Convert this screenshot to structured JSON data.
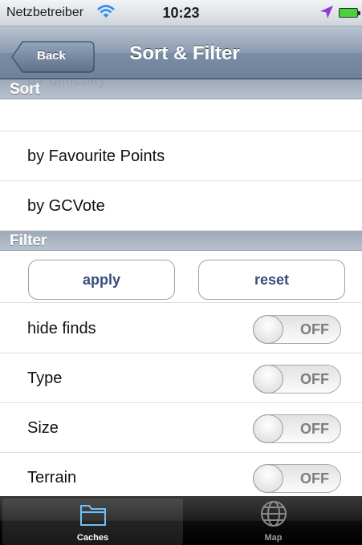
{
  "status_bar": {
    "carrier": "Netzbetreiber",
    "time": "10:23"
  },
  "navbar": {
    "back_label": "Back",
    "title": "Sort & Filter"
  },
  "sort": {
    "header": "Sort",
    "items": [
      "by difficulty",
      "by Favourite Points",
      "by GCVote"
    ]
  },
  "filter": {
    "header": "Filter",
    "apply_label": "apply",
    "reset_label": "reset",
    "toggles": [
      {
        "label": "hide finds",
        "state": "OFF"
      },
      {
        "label": "Type",
        "state": "OFF"
      },
      {
        "label": "Size",
        "state": "OFF"
      },
      {
        "label": "Terrain",
        "state": "OFF"
      }
    ]
  },
  "tabbar": {
    "tabs": [
      {
        "label": "Caches",
        "icon": "folder-icon",
        "active": true
      },
      {
        "label": "Map",
        "icon": "globe-icon",
        "active": false
      }
    ]
  },
  "colors": {
    "nav_blue": "#6e819a",
    "button_text": "#384d7a",
    "battery_green": "#4cd13c",
    "location_arrow": "#8a3bd6"
  }
}
